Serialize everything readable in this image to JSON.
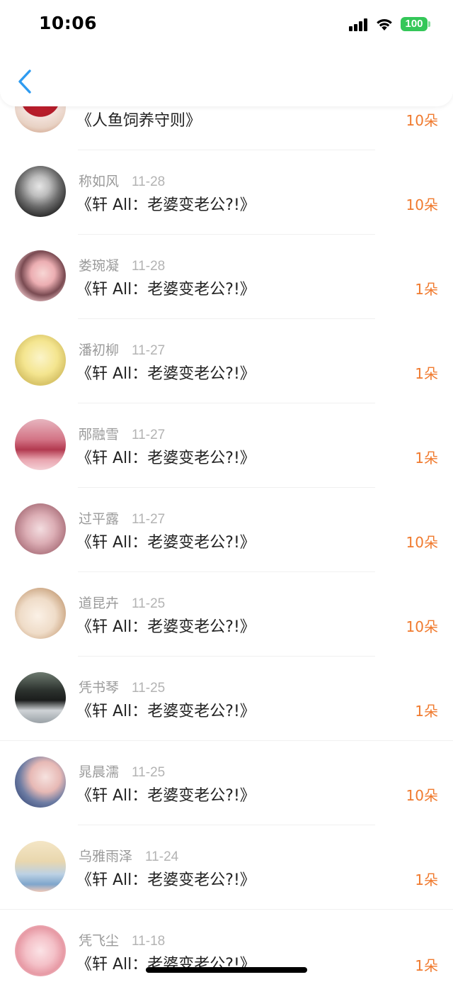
{
  "status_bar": {
    "time": "10:06",
    "battery": "100"
  },
  "colors": {
    "accent": "#2e9bf0",
    "amount": "#f07a2e",
    "battery": "#34c759"
  },
  "list": {
    "items": [
      {
        "name": "",
        "date": "",
        "title": "《人鱼饲养守则》",
        "amount": "10朵",
        "avatar": "cupcake-avatar"
      },
      {
        "name": "称如风",
        "date": "11-28",
        "title": "《轩 All：老婆变老公?!》",
        "amount": "10朵",
        "avatar": "grayscale-girl-avatar"
      },
      {
        "name": "娄琬凝",
        "date": "11-28",
        "title": "《轩 All：老婆变老公?!》",
        "amount": "1朵",
        "avatar": "pink-girl-avatar"
      },
      {
        "name": "潘初柳",
        "date": "11-27",
        "title": "《轩 All：老婆变老公?!》",
        "amount": "1朵",
        "avatar": "sketch-girl-avatar"
      },
      {
        "name": "邴融雪",
        "date": "11-27",
        "title": "《轩 All：老婆变老公?!》",
        "amount": "1朵",
        "avatar": "sunset-hand-avatar"
      },
      {
        "name": "过平露",
        "date": "11-27",
        "title": "《轩 All：老婆变老公?!》",
        "amount": "10朵",
        "avatar": "soft-girl-avatar"
      },
      {
        "name": "道昆卉",
        "date": "11-25",
        "title": "《轩 All：老婆变老公?!》",
        "amount": "10朵",
        "avatar": "cream-person-avatar"
      },
      {
        "name": "凭书琴",
        "date": "11-25",
        "title": "《轩 All：老婆变老公?!》",
        "amount": "1朵",
        "avatar": "car-person-avatar"
      },
      {
        "name": "晁晨濡",
        "date": "11-25",
        "title": "《轩 All：老婆变老公?!》",
        "amount": "10朵",
        "avatar": "girl-window-avatar"
      },
      {
        "name": "乌雅雨泽",
        "date": "11-24",
        "title": "《轩 All：老婆变老公?!》",
        "amount": "1朵",
        "avatar": "calligraphy-avatar"
      },
      {
        "name": "凭飞尘",
        "date": "11-18",
        "title": "《轩 All：老婆变老公?!》",
        "amount": "1朵",
        "avatar": "sheep-avatar"
      }
    ]
  }
}
